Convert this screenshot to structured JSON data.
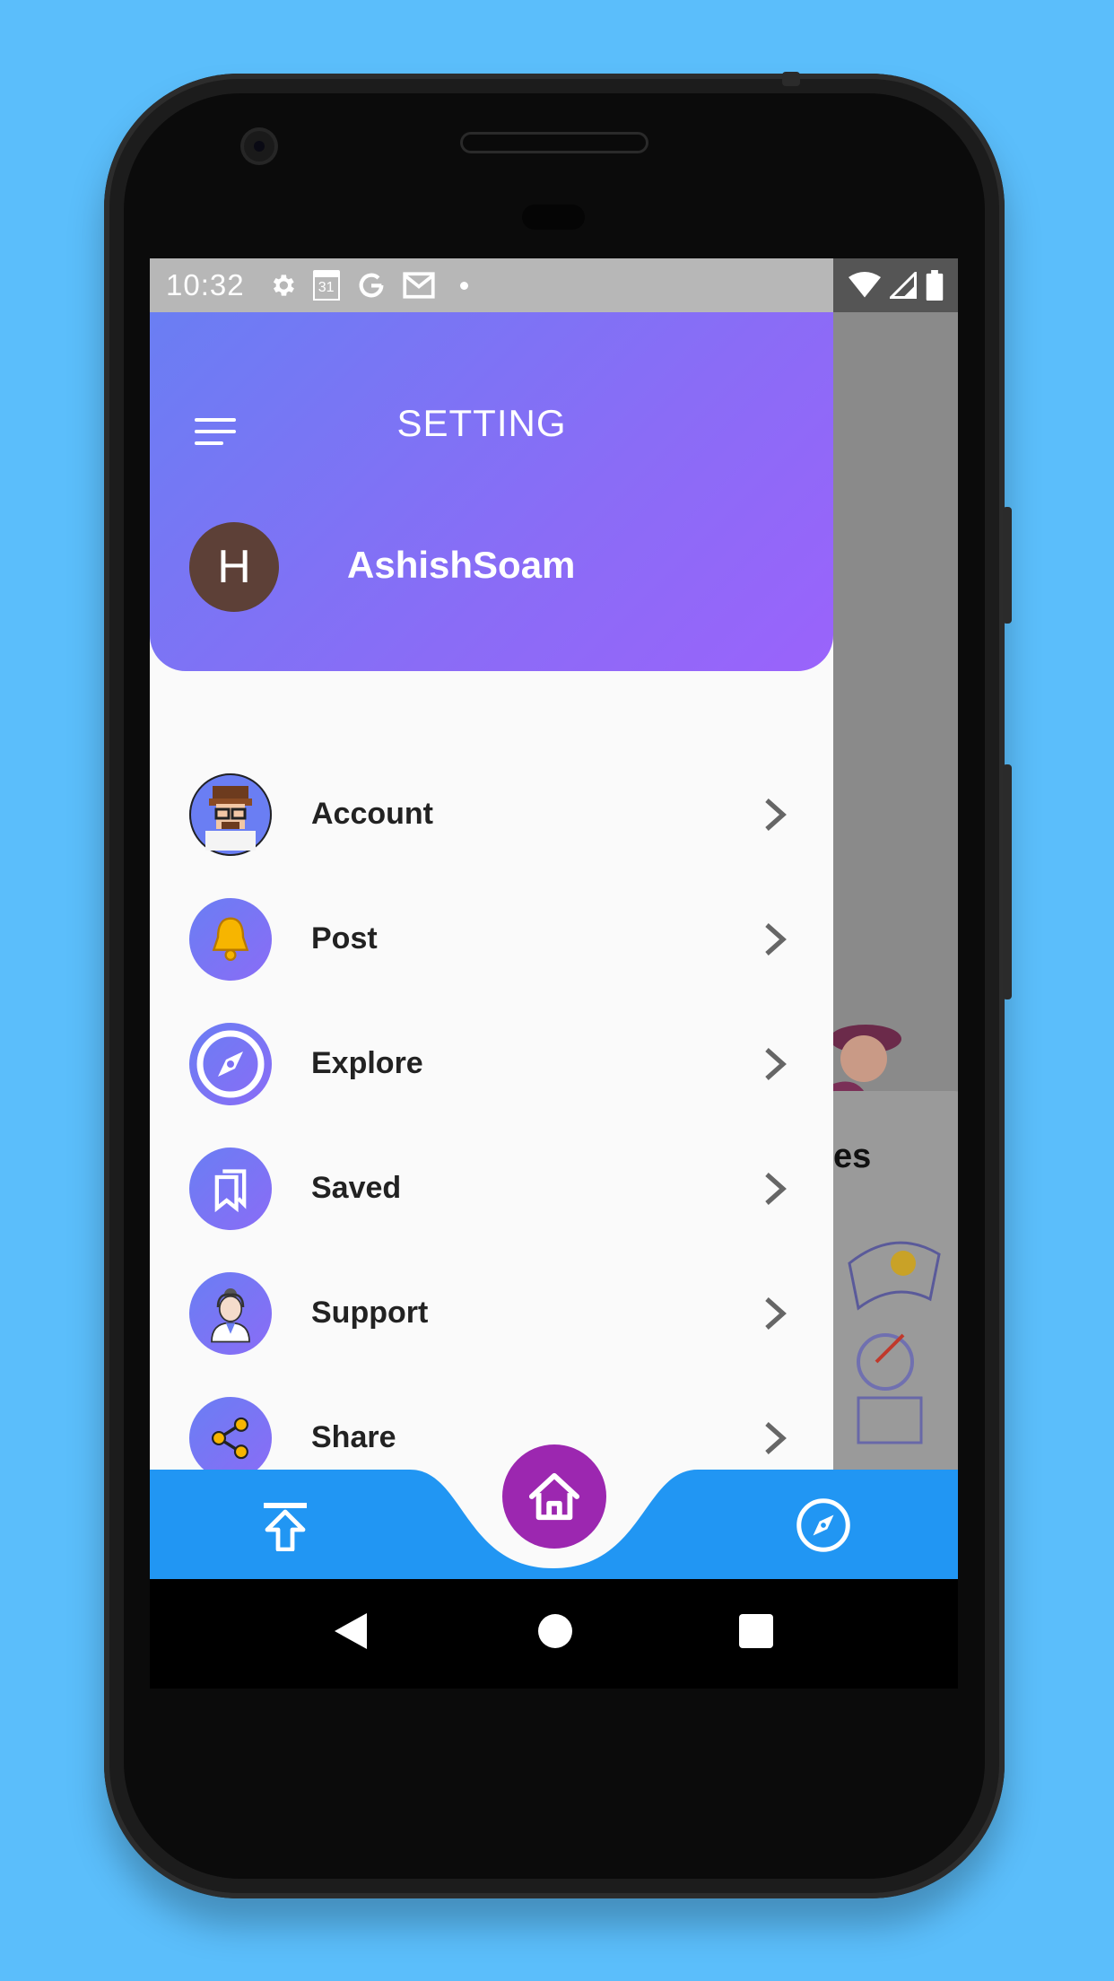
{
  "status_bar": {
    "time": "10:32",
    "left_icons": [
      "gear-icon",
      "calendar-icon",
      "google-icon",
      "gmail-icon",
      "dot-icon"
    ],
    "calendar_day": "31",
    "right_icons": [
      "wifi-icon",
      "signal-icon",
      "battery-icon"
    ]
  },
  "drawer": {
    "title": "SETTING",
    "avatar_letter": "H",
    "username": "AshishSoam",
    "items": [
      {
        "label": "Account",
        "icon": "account-avatar-icon"
      },
      {
        "label": "Post",
        "icon": "bell-icon"
      },
      {
        "label": "Explore",
        "icon": "compass-icon"
      },
      {
        "label": "Saved",
        "icon": "bookmark-icon"
      },
      {
        "label": "Support",
        "icon": "support-agent-icon"
      },
      {
        "label": "Share",
        "icon": "share-icon"
      }
    ]
  },
  "background": {
    "partial_text": "es"
  },
  "bottom_nav": {
    "left_icon": "upload-icon",
    "center_icon": "home-icon",
    "right_icon": "compass-icon"
  },
  "colors": {
    "page_background": "#5bbefb",
    "header_gradient_start": "#6a7ef3",
    "header_gradient_end": "#9a63fb",
    "avatar_bg": "#5d4037",
    "bottom_bar": "#2196f3",
    "fab": "#9c27b0"
  }
}
